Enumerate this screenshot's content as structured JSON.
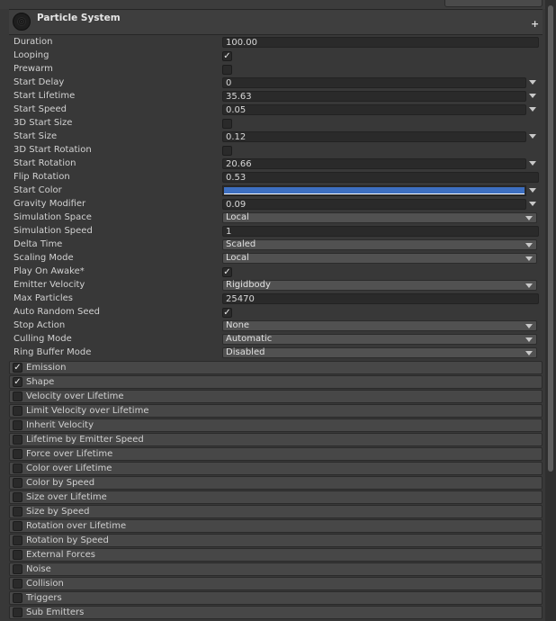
{
  "header": {
    "title": "Particle System",
    "add_label": "+"
  },
  "properties": [
    {
      "label": "Duration",
      "type": "text",
      "value": "100.00"
    },
    {
      "label": "Looping",
      "type": "checkbox",
      "checked": true
    },
    {
      "label": "Prewarm",
      "type": "checkbox",
      "checked": false
    },
    {
      "label": "Start Delay",
      "type": "text-mode",
      "value": "0"
    },
    {
      "label": "Start Lifetime",
      "type": "text-mode",
      "value": "35.63"
    },
    {
      "label": "Start Speed",
      "type": "text-mode",
      "value": "0.05"
    },
    {
      "label": "3D Start Size",
      "type": "checkbox",
      "checked": false
    },
    {
      "label": "Start Size",
      "type": "text-mode",
      "value": "0.12"
    },
    {
      "label": "3D Start Rotation",
      "type": "checkbox",
      "checked": false
    },
    {
      "label": "Start Rotation",
      "type": "text-mode",
      "value": "20.66"
    },
    {
      "label": "Flip Rotation",
      "type": "text",
      "value": "0.53"
    },
    {
      "label": "Start Color",
      "type": "color",
      "color": "#3d6fc1"
    },
    {
      "label": "Gravity Modifier",
      "type": "text-mode",
      "value": "0.09"
    },
    {
      "label": "Simulation Space",
      "type": "dropdown",
      "value": "Local"
    },
    {
      "label": "Simulation Speed",
      "type": "text",
      "value": "1"
    },
    {
      "label": "Delta Time",
      "type": "dropdown",
      "value": "Scaled"
    },
    {
      "label": "Scaling Mode",
      "type": "dropdown",
      "value": "Local"
    },
    {
      "label": "Play On Awake*",
      "type": "checkbox",
      "checked": true
    },
    {
      "label": "Emitter Velocity",
      "type": "dropdown",
      "value": "Rigidbody"
    },
    {
      "label": "Max Particles",
      "type": "text",
      "value": "25470"
    },
    {
      "label": "Auto Random Seed",
      "type": "checkbox",
      "checked": true
    },
    {
      "label": "Stop Action",
      "type": "dropdown",
      "value": "None"
    },
    {
      "label": "Culling Mode",
      "type": "dropdown",
      "value": "Automatic"
    },
    {
      "label": "Ring Buffer Mode",
      "type": "dropdown",
      "value": "Disabled"
    }
  ],
  "modules": [
    {
      "label": "Emission",
      "checked": true
    },
    {
      "label": "Shape",
      "checked": true
    },
    {
      "label": "Velocity over Lifetime",
      "checked": false
    },
    {
      "label": "Limit Velocity over Lifetime",
      "checked": false
    },
    {
      "label": "Inherit Velocity",
      "checked": false
    },
    {
      "label": "Lifetime by Emitter Speed",
      "checked": false
    },
    {
      "label": "Force over Lifetime",
      "checked": false
    },
    {
      "label": "Color over Lifetime",
      "checked": false
    },
    {
      "label": "Color by Speed",
      "checked": false
    },
    {
      "label": "Size over Lifetime",
      "checked": false
    },
    {
      "label": "Size by Speed",
      "checked": false
    },
    {
      "label": "Rotation over Lifetime",
      "checked": false
    },
    {
      "label": "Rotation by Speed",
      "checked": false
    },
    {
      "label": "External Forces",
      "checked": false
    },
    {
      "label": "Noise",
      "checked": false
    },
    {
      "label": "Collision",
      "checked": false
    },
    {
      "label": "Triggers",
      "checked": false
    },
    {
      "label": "Sub Emitters",
      "checked": false
    }
  ],
  "icons": {
    "component": "particle-system-icon",
    "add": "plus-icon",
    "check": "checkmark-icon",
    "dropdown": "chevron-down-icon"
  }
}
